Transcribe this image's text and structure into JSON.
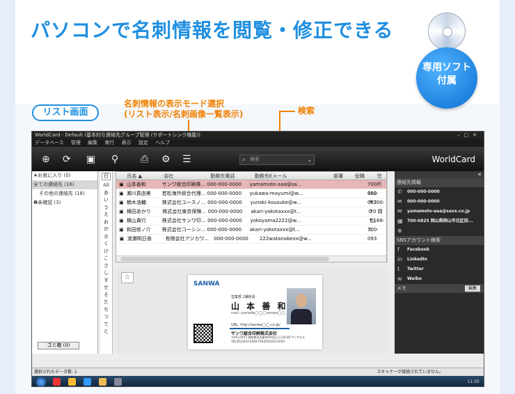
{
  "page": {
    "headline": "パソコンで名刺情報を閲覧・修正できる",
    "badge": "専用ソフト\n付属",
    "badge_lines": [
      "専用ソフト",
      "付属"
    ],
    "list_label": "リスト画面",
    "callout_mode": "名刺情報の表示モード選択",
    "callout_mode_sub": "(リスト表示/名刺画像一覧表示)",
    "callout_search": "検索"
  },
  "app": {
    "title": "WorldCard - Default (基本的な連絡先グループ管理 (サポートシンク機能))",
    "menu": [
      "データベース",
      "管理",
      "編集",
      "実行",
      "表示",
      "設定",
      "ヘルプ"
    ],
    "search_placeholder": "検索",
    "brand": "WorldCard",
    "nav": [
      {
        "label": "★お気に入り (0)",
        "selected": false,
        "indent": false
      },
      {
        "label": "全ての連絡先 (16)",
        "selected": true,
        "indent": false
      },
      {
        "label": "その他の連絡先 (18)",
        "selected": false,
        "indent": true
      },
      {
        "label": "❶未確認 (3)",
        "selected": false,
        "indent": false
      }
    ],
    "trash": "ゴミ箱 (0)",
    "kana_tab": "日",
    "kana_letters": [
      "All",
      "あ",
      "い",
      "う",
      "え",
      "お",
      "か",
      "き",
      "く",
      "け",
      "こ",
      "さ",
      "し",
      "す",
      "せ",
      "そ",
      "た",
      "ち",
      "つ",
      "て",
      "と"
    ],
    "columns": [
      "",
      "氏名 ▲",
      "会社",
      "勤務先電話",
      "勤務先Eメール",
      "部署",
      "役職",
      "住所"
    ],
    "rows": [
      [
        "▣",
        "山本善和",
        "サンワ総合印刷株...",
        "000-000-0000",
        "yamamoto-aaa@sa...",
        "",
        "",
        "700-082"
      ],
      [
        "▣",
        "瀬川真由美",
        "若松海外総合代理...",
        "000-000-0000",
        "yukawa-mayumi@w...",
        "",
        "",
        "700-082"
      ],
      [
        "▣",
        "楠木浩輔",
        "株式会社ユースノ...",
        "000-000-0000",
        "yunoki-kousuke@w...",
        "",
        "",
        "〒700-0"
      ],
      [
        "▣",
        "横田あかり",
        "株式会社東京保険...",
        "000-000-0000",
        "akari-yokotaxxx@t...",
        "",
        "",
        "70 岡山"
      ],
      [
        "▣",
        "横山貴行",
        "株式会社サンワ印...",
        "000-000-0000",
        "yokoyama2222@w...",
        "",
        "",
        "〒168-0"
      ],
      [
        "▣",
        "和田修ノ介",
        "株式会社コーシン...",
        "000-000-0000",
        "akari-yokotaxxx@t...",
        "",
        "",
        "700-093"
      ],
      [
        "▣",
        "渡瀬明日香",
        "有限会社アジカワ...",
        "000-000-0000",
        "222watanabexx@w...",
        "",
        "",
        ""
      ]
    ],
    "selected_row": 0,
    "right_panel": {
      "close": "✕",
      "contact_title": "連絡先情報",
      "contact": [
        {
          "icon": "phone-icon",
          "glyph": "✆",
          "text": "000-000-0000"
        },
        {
          "icon": "chat-icon",
          "glyph": "✉",
          "text": "000-000-0000"
        },
        {
          "icon": "mail-icon",
          "glyph": "✉",
          "text": "yamamoto-aaa@saxx.co.jp"
        },
        {
          "icon": "building-icon",
          "glyph": "▦",
          "text": "700-0825 岡山県岡山市北区田..."
        },
        {
          "icon": "globe-icon",
          "glyph": "⊕",
          "text": ""
        }
      ],
      "sns_title": "SNSアカウント検索",
      "sns": [
        {
          "icon": "facebook-icon",
          "glyph": "f",
          "text": "Facebook"
        },
        {
          "icon": "linkedin-icon",
          "glyph": "in",
          "text": "LinkedIn"
        },
        {
          "icon": "twitter-icon",
          "glyph": "t",
          "text": "Twitter"
        },
        {
          "icon": "weibo-icon",
          "glyph": "w",
          "text": "Weibo"
        }
      ],
      "memo_title": "メモ",
      "edit": "編集"
    },
    "card": {
      "logo": "SANWA",
      "dept": "営業部 2課係長",
      "name": "山 本  善 和",
      "mail": "mail: yamada◯◯◯sanwa◯◯.co.jp",
      "url": "URL: http://sanwa◯◯.co.jp/",
      "company": "サンワ総合印刷株式会社",
      "addr": "〒453-0015 愛知県名古屋市中村区◯◯16-00 サンワビル",
      "tel": "TEL(052)453-XXXX  FAX(052)453-XXXX"
    },
    "status_left": "選択されたデータ数: 1",
    "status_right": "スキャナーが接続されていません。",
    "clock": "11:05"
  },
  "colors": {
    "accent": "#1f8fe0",
    "callout": "#f08000",
    "selected_row": "#e8b6b6"
  }
}
